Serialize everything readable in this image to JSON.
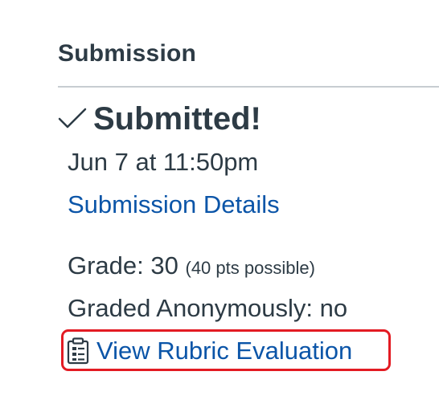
{
  "submission": {
    "section_title": "Submission",
    "status": "Submitted!",
    "date": "Jun 7 at 11:50pm",
    "details_link": "Submission Details",
    "grade_label": "Grade: 30",
    "grade_possible": "(40 pts possible)",
    "graded_anonymously": "Graded Anonymously: no",
    "rubric_link": "View Rubric Evaluation"
  },
  "icons": {
    "status": "checkmark-icon",
    "rubric": "clipboard-rubric-icon"
  },
  "colors": {
    "text": "#2d3b45",
    "link": "#0b55a8",
    "divider": "#c7cdd1",
    "highlight_border": "#e31b23"
  }
}
